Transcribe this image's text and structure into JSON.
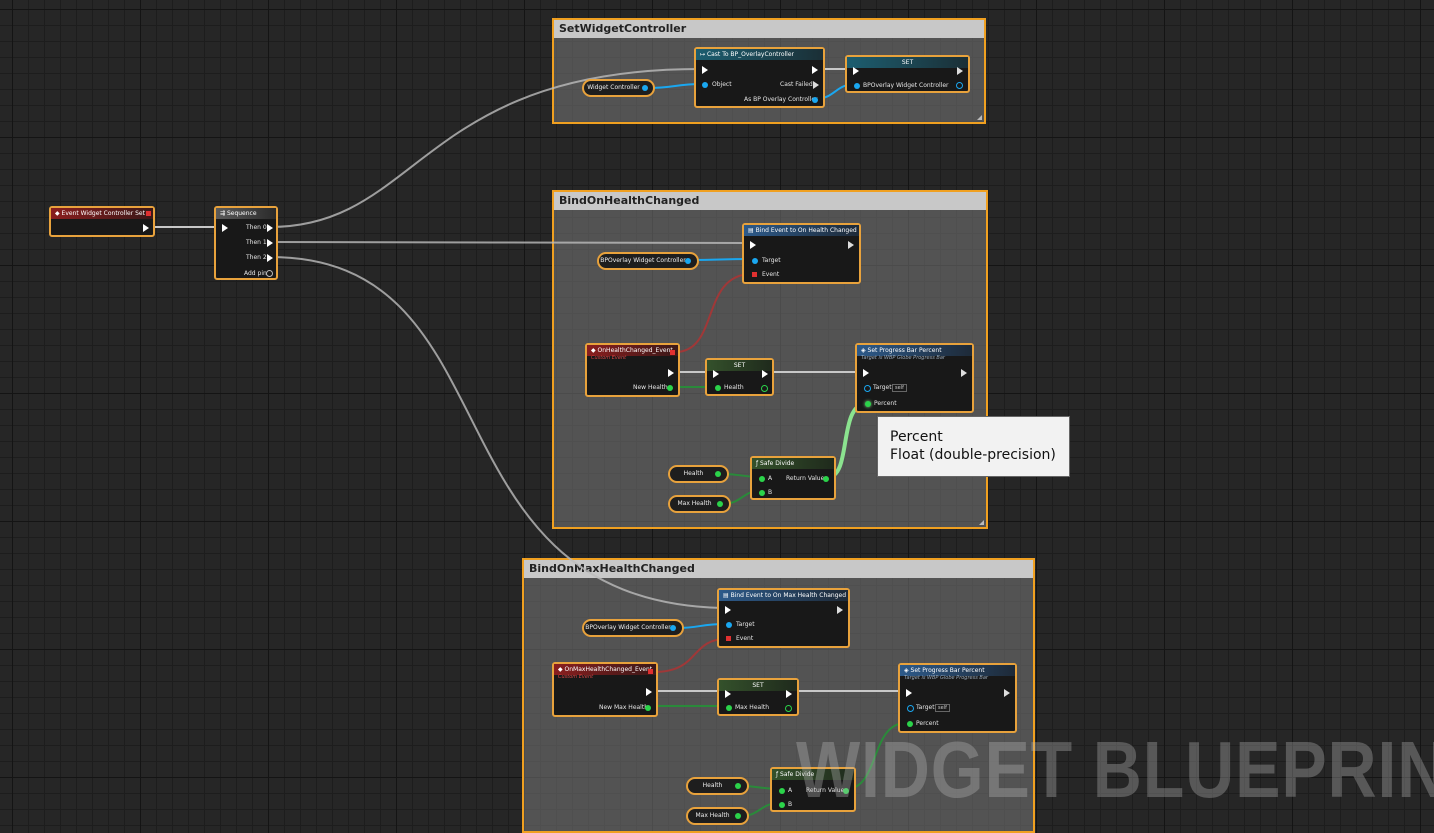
{
  "comments": {
    "set_widget_controller": "SetWidgetController",
    "bind_health": "BindOnHealthChanged",
    "bind_max_health": "BindOnMaxHealthChanged"
  },
  "event_node": {
    "title": "Event Widget Controller Set"
  },
  "sequence": {
    "title": "Sequence",
    "pins": [
      "Then 0",
      "Then 1",
      "Then 2"
    ],
    "add_pin": "Add pin"
  },
  "set_widget_controller": {
    "widget_controller_var": "Widget Controller",
    "cast": {
      "title": "Cast To BP_OverlayController",
      "object": "Object",
      "cast_failed": "Cast Failed",
      "as_output": "As BP Overlay Controller"
    },
    "set": {
      "title": "SET",
      "var": "BPOverlay Widget Controller"
    }
  },
  "bind_health": {
    "controller_var": "BPOverlay Widget Controller",
    "bind_event": {
      "title": "Bind Event to On Health Changed",
      "target": "Target",
      "event": "Event"
    },
    "custom_event": {
      "title": "OnHealthChanged_Event",
      "subtitle": "Custom Event",
      "output": "New Health"
    },
    "set": {
      "title": "SET",
      "var": "Health"
    },
    "progress": {
      "title": "Set Progress Bar Percent",
      "subtitle": "Target is WBP Globe Progress Bar",
      "target": "Target",
      "self": "self",
      "percent": "Percent"
    },
    "health_var": "Health",
    "max_health_var": "Max Health",
    "divide": {
      "title": "Safe Divide",
      "a": "A",
      "b": "B",
      "return": "Return Value"
    }
  },
  "bind_max_health": {
    "controller_var": "BPOverlay Widget Controller",
    "bind_event": {
      "title": "Bind Event to On Max Health Changed",
      "target": "Target",
      "event": "Event"
    },
    "custom_event": {
      "title": "OnMaxHealthChanged_Event",
      "subtitle": "Custom Event",
      "output": "New Max Health"
    },
    "set": {
      "title": "SET",
      "var": "Max Health"
    },
    "progress": {
      "title": "Set Progress Bar Percent",
      "subtitle": "Target is WBP Globe Progress Bar",
      "target": "Target",
      "self": "self",
      "percent": "Percent"
    },
    "health_var": "Health",
    "max_health_var": "Max Health",
    "divide": {
      "title": "Safe Divide",
      "a": "A",
      "b": "B",
      "return": "Return Value"
    }
  },
  "tooltip": {
    "line1": "Percent",
    "line2": "Float (double-precision)"
  },
  "watermark": "WIDGET BLUEPRINT",
  "colors": {
    "exec_wire": "#c8c8c8",
    "object_wire": "#1aa7f0",
    "float_wire": "#2bd34a",
    "delegate_wire": "#b04040",
    "selection": "#e8a23c"
  }
}
